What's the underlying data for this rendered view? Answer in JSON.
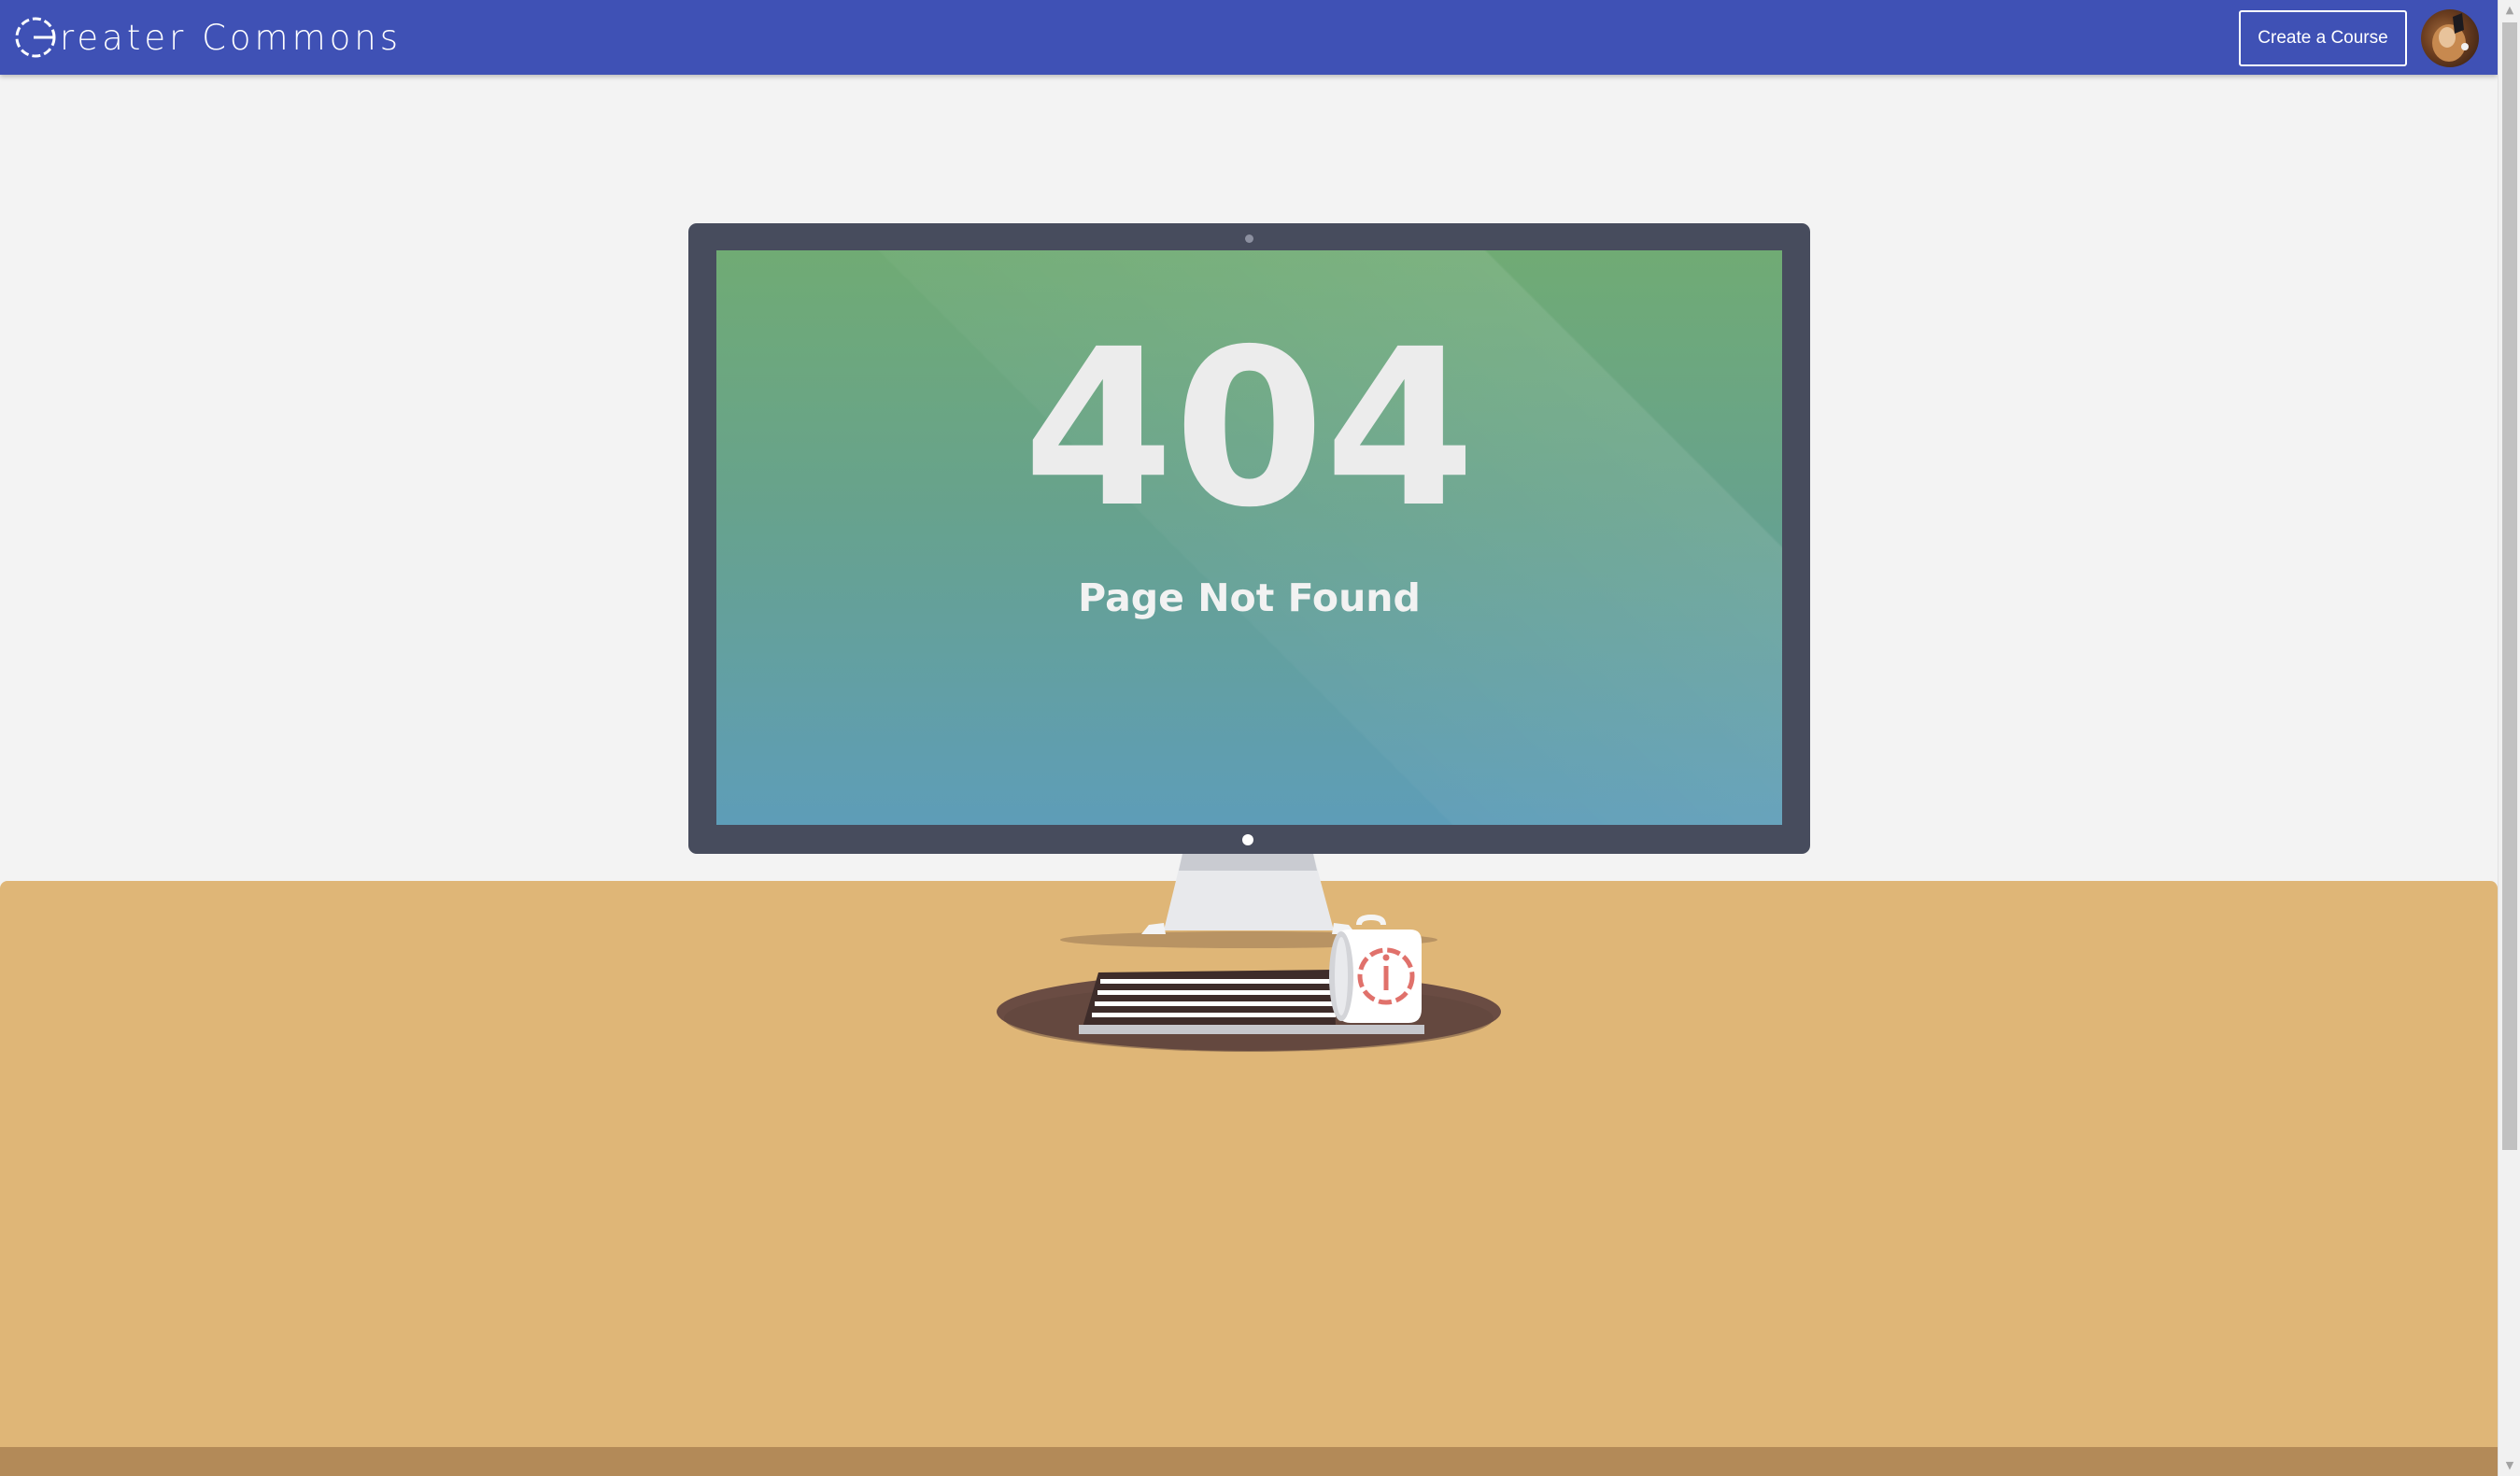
{
  "header": {
    "brand_name": "reater Commons",
    "brand_icon": "greater-commons-logo-icon",
    "create_course_label": "Create a Course",
    "avatar_icon": "user-avatar",
    "background_color": "#3f51b5"
  },
  "error": {
    "code": "404",
    "message": "Page Not Found"
  },
  "colors": {
    "page_background": "#f3f3f3",
    "desk": "#dfb677",
    "monitor_frame": "#474c5d",
    "screen_top": "#70ab74",
    "screen_bottom": "#5e9db8",
    "mug_icon_color": "#e0716b"
  }
}
